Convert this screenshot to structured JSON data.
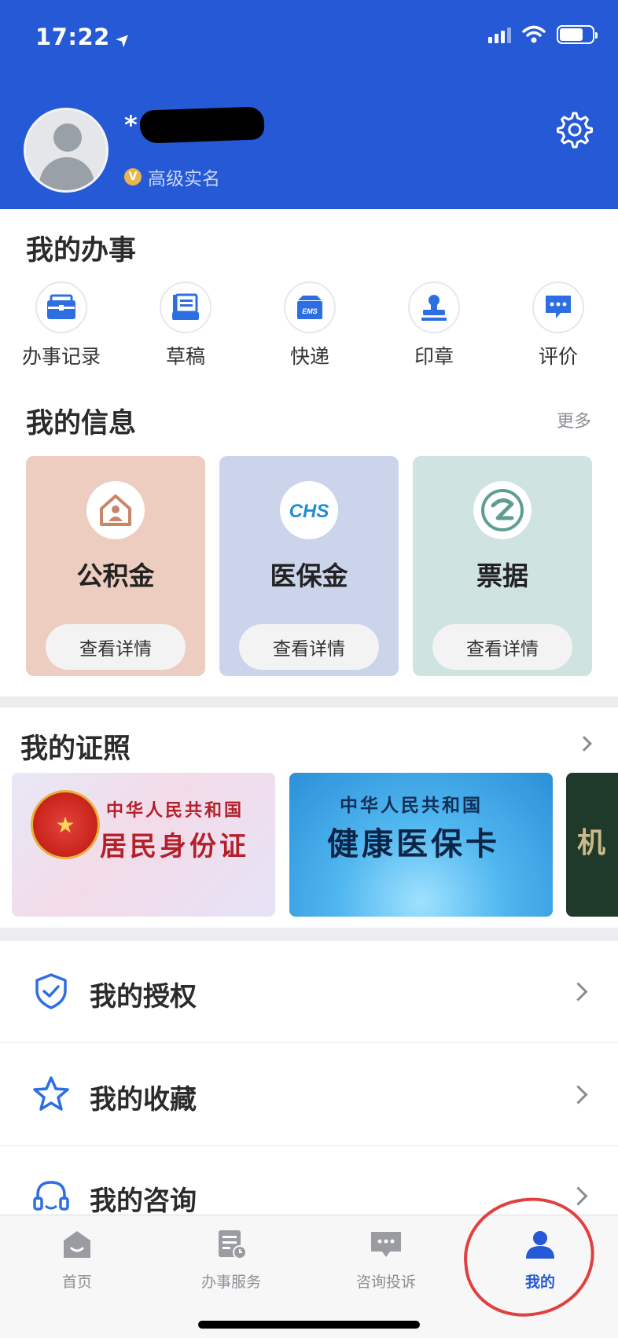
{
  "status_bar": {
    "time": "17:22",
    "location_arrow": "➤"
  },
  "profile": {
    "username": "*",
    "verification_badge": "V",
    "verification_text": "高级实名"
  },
  "my_tasks": {
    "title": "我的办事",
    "items": [
      {
        "label": "办事记录",
        "icon": "briefcase-icon"
      },
      {
        "label": "草稿",
        "icon": "draft-icon"
      },
      {
        "label": "快递",
        "icon": "ems-box-icon",
        "icon_text": "EMS"
      },
      {
        "label": "印章",
        "icon": "stamp-icon"
      },
      {
        "label": "评价",
        "icon": "comment-icon"
      }
    ]
  },
  "my_info": {
    "title": "我的信息",
    "more": "更多",
    "cards": [
      {
        "name": "公积金",
        "button": "查看详情",
        "color": "#eccdbf",
        "icon": "house-icon"
      },
      {
        "name": "医保金",
        "button": "查看详情",
        "color": "#cbd4eb",
        "icon": "chs-logo-icon",
        "icon_text": "CHS"
      },
      {
        "name": "票据",
        "button": "查看详情",
        "color": "#cfe3e0",
        "icon": "receipt-logo-icon"
      }
    ]
  },
  "my_licenses": {
    "title": "我的证照",
    "cards": [
      {
        "line1": "中华人民共和国",
        "line2": "居民身份证"
      },
      {
        "line1": "中华人民共和国",
        "line2": "健康医保卡"
      },
      {
        "line2": "机"
      }
    ]
  },
  "menu": {
    "items": [
      {
        "label": "我的授权",
        "icon": "shield-check-icon"
      },
      {
        "label": "我的收藏",
        "icon": "star-icon"
      },
      {
        "label": "我的咨询",
        "icon": "headset-icon"
      }
    ]
  },
  "tabbar": {
    "items": [
      {
        "label": "首页",
        "icon": "home-icon"
      },
      {
        "label": "办事服务",
        "icon": "service-icon"
      },
      {
        "label": "咨询投诉",
        "icon": "chat-icon"
      },
      {
        "label": "我的",
        "icon": "user-icon",
        "active": true
      }
    ]
  },
  "colors": {
    "primary": "#2559d6",
    "annotation": "#e04040"
  }
}
